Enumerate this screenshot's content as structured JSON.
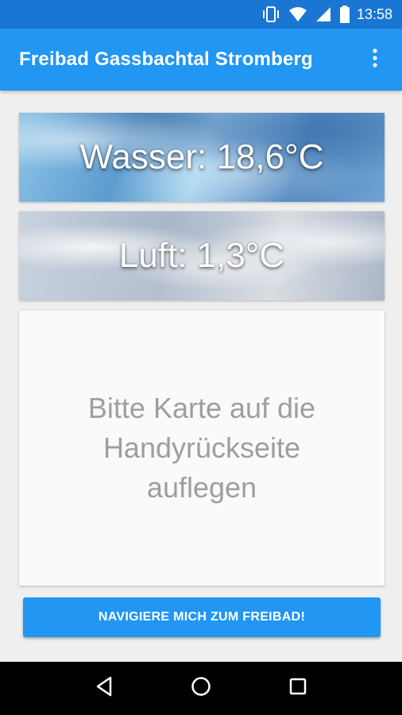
{
  "status_bar": {
    "time": "13:58",
    "icons": [
      "vibrate-icon",
      "wifi-icon",
      "signal-icon",
      "battery-icon"
    ]
  },
  "app_bar": {
    "title": "Freibad Gassbachtal Stromberg",
    "overflow_icon": "more-vert-icon"
  },
  "cards": {
    "water": {
      "label": "Wasser: 18,6°C"
    },
    "air": {
      "label": "Luft: 1,3°C"
    },
    "nfc": {
      "line1": "Bitte Karte auf die",
      "line2": "Handyrückseite",
      "line3": "auflegen"
    }
  },
  "navigate_button": {
    "label": "NAVIGIERE MICH ZUM FREIBAD!"
  },
  "system_nav": {
    "back": "back-icon",
    "home": "home-icon",
    "recents": "recents-icon"
  },
  "colors": {
    "status_bar": "#1976d2",
    "app_bar": "#2196f3",
    "button": "#2196f3",
    "background": "#efefef"
  }
}
